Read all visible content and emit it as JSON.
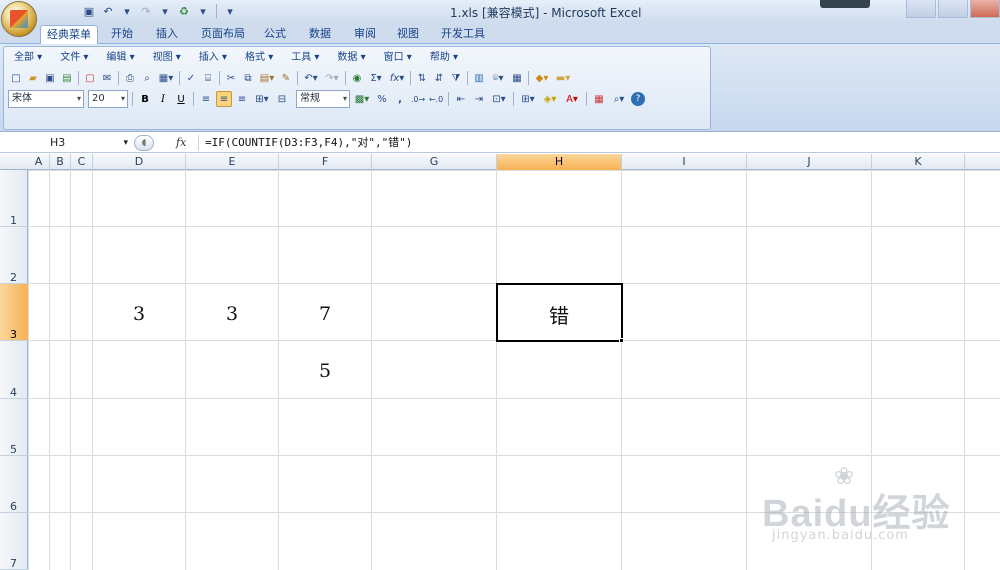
{
  "window": {
    "title": "1.xls  [兼容模式] - Microsoft Excel"
  },
  "quick_access": {
    "undo_icon": "↶",
    "redo_icon": "↷",
    "dropdown": "▾"
  },
  "tabs": [
    "经典菜单",
    "开始",
    "插入",
    "页面布局",
    "公式",
    "数据",
    "审阅",
    "视图",
    "开发工具"
  ],
  "menu": [
    "全部",
    "文件",
    "编辑",
    "视图",
    "插入",
    "格式",
    "工具",
    "数据",
    "窗口",
    "帮助"
  ],
  "toolbar": {
    "font_name": "宋体",
    "font_size": "20",
    "bold": "B",
    "italic": "I",
    "underline": "U",
    "number_format": "常规",
    "percent": "%",
    "comma": ",",
    "sum": "Σ",
    "fx": "fx"
  },
  "formula_bar": {
    "name_box": "H3",
    "fx_label": "fx",
    "formula": "=IF(COUNTIF(D3:F3,F4),\"对\",\"错\")"
  },
  "columns": [
    "A",
    "B",
    "C",
    "D",
    "E",
    "F",
    "G",
    "H",
    "I",
    "J",
    "K"
  ],
  "selected_column": "H",
  "rows": [
    "1",
    "2",
    "3",
    "4",
    "5",
    "6",
    "7"
  ],
  "selected_row": "3",
  "cells": {
    "D3": "3",
    "E3": "3",
    "F3": "7",
    "F4": "5",
    "H3": "错"
  },
  "watermark": {
    "brand": "Baidu经验",
    "url": "jingyan.baidu.com"
  }
}
